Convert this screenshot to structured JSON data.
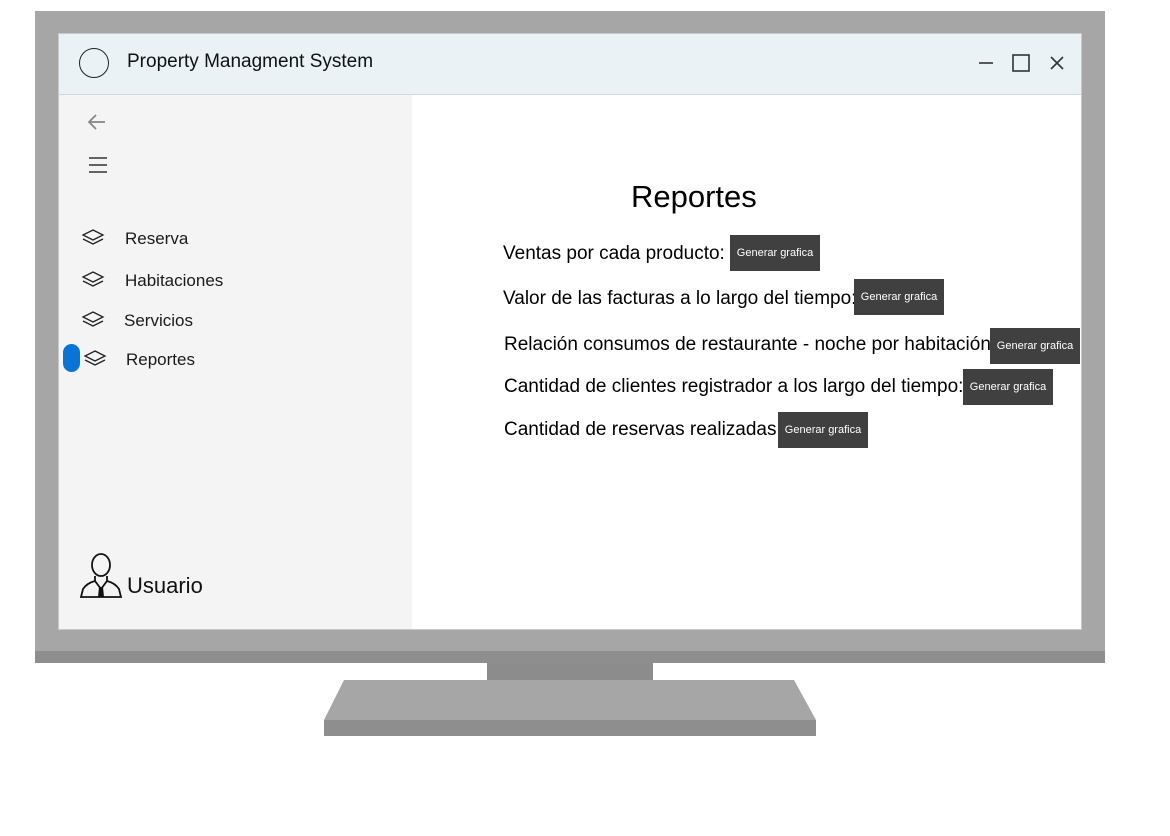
{
  "window": {
    "title": "Property Managment System",
    "controls": [
      "minimize-icon",
      "maximize-icon",
      "close-icon"
    ]
  },
  "sidebar": {
    "icons": [
      "arrow-left-icon",
      "hamburger-menu-icon",
      "layers-icon"
    ],
    "items": [
      {
        "label": "Reserva",
        "active": false
      },
      {
        "label": "Habitaciones",
        "active": false
      },
      {
        "label": "Servicios",
        "active": false
      },
      {
        "label": "Reportes",
        "active": true
      }
    ],
    "user": {
      "label": "Usuario",
      "icon": "user-icon"
    }
  },
  "main": {
    "title": "Reportes",
    "reports": [
      {
        "label": "Ventas por cada producto:",
        "button": "Generar grafica"
      },
      {
        "label": "Valor de las facturas a lo largo del tiempo:",
        "button": "Generar grafica"
      },
      {
        "label": "Relación consumos de restaurante - noche por habitación:",
        "button": "Generar grafica"
      },
      {
        "label": "Cantidad de clientes registrador a los largo del tiempo:",
        "button": "Generar grafica"
      },
      {
        "label": "Cantidad de reservas realizadas:",
        "button": "Generar grafica"
      }
    ]
  },
  "colors": {
    "accent": "#0a74d6",
    "titlebar": "#eaf2f6",
    "sidebar": "#f4f4f4",
    "button": "#404040",
    "monitor": "#a6a6a6"
  }
}
